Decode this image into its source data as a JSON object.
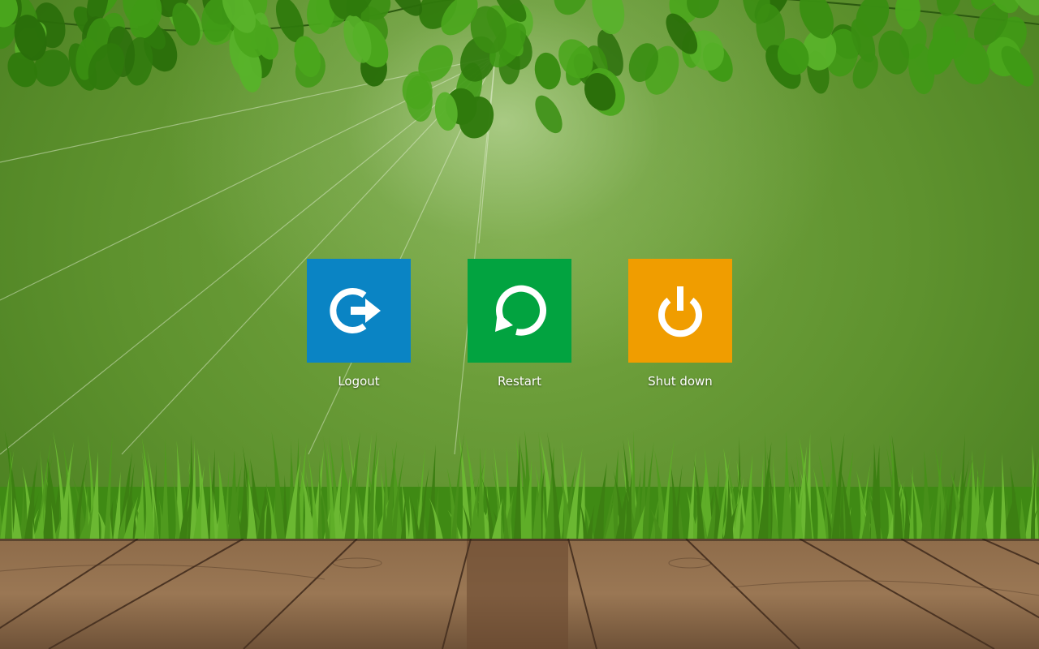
{
  "power_menu": {
    "options": [
      {
        "label": "Logout",
        "icon": "logout-arrow-icon",
        "color": "#0a84c4"
      },
      {
        "label": "Restart",
        "icon": "restart-circle-icon",
        "color": "#02a340"
      },
      {
        "label": "Shut down",
        "icon": "power-icon",
        "color": "#f09d00"
      }
    ]
  },
  "wallpaper": {
    "theme": "green leaves, grass and wooden deck",
    "colors": {
      "sky": "#6a9e38",
      "grass": "#4f9a1e",
      "wood": "#8a6846",
      "leaf": "#3f9a15"
    }
  }
}
